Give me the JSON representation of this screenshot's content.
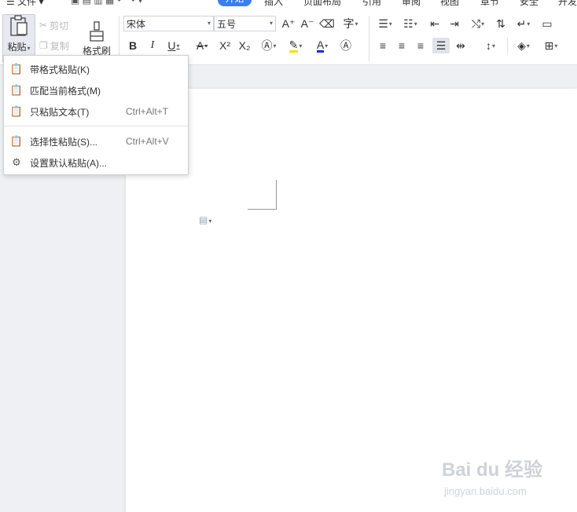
{
  "menu_tabs": [
    {
      "label": "文件",
      "active": false
    },
    {
      "label": "开始",
      "active": true
    },
    {
      "label": "插入",
      "active": false
    },
    {
      "label": "页面布局",
      "active": false
    },
    {
      "label": "引用",
      "active": false
    },
    {
      "label": "审阅",
      "active": false
    },
    {
      "label": "视图",
      "active": false
    },
    {
      "label": "章节",
      "active": false
    },
    {
      "label": "安全",
      "active": false
    },
    {
      "label": "开发",
      "active": false
    }
  ],
  "clipboard": {
    "paste_label": "粘贴",
    "cut_label": "剪切",
    "copy_label": "复制",
    "format_painter_label": "格式刷"
  },
  "font": {
    "family": "宋体",
    "size": "五号"
  },
  "paste_menu": {
    "items": [
      {
        "label": "带格式粘贴(K)",
        "shortcut": "",
        "icon": "paste-with-format-icon"
      },
      {
        "label": "匹配当前格式(M)",
        "shortcut": "",
        "icon": "match-format-icon"
      },
      {
        "label": "只粘贴文本(T)",
        "shortcut": "Ctrl+Alt+T",
        "icon": "paste-text-only-icon"
      },
      {
        "label": "选择性粘贴(S)...",
        "shortcut": "Ctrl+Alt+V",
        "icon": "paste-special-icon"
      },
      {
        "label": "设置默认粘贴(A)...",
        "shortcut": "",
        "icon": "default-paste-settings-icon"
      }
    ]
  },
  "watermark": {
    "brand": "Bai du 经验",
    "url": "jingyan.baidu.com"
  },
  "colors": {
    "accent": "#3d7cf5",
    "highlight": "#f5e100",
    "font_color": "#1a2ecc"
  }
}
